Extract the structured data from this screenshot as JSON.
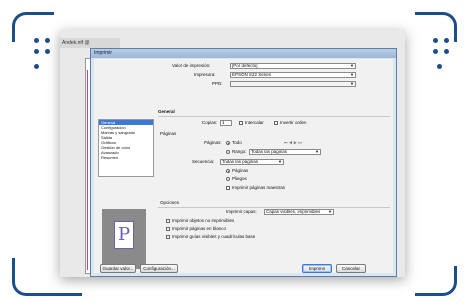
{
  "background_doc": {
    "tab_label": "Andek.ntf @"
  },
  "dialog": {
    "title": "Imprimir",
    "valor_label": "Valor de impresión:",
    "valor_value": "[Por defecto]",
    "impresora_label": "Impresora:",
    "impresora_value": "EPSON S22 Series",
    "ppd_label": "PPD:",
    "ppd_value": "",
    "sidebar": [
      "General",
      "Configuración",
      "Marcas y sangrado",
      "Salida",
      "Gráficos",
      "Gestión de color",
      "Avanzado",
      "Resumen"
    ],
    "general_title": "General",
    "copias_label": "Copias:",
    "copias_value": "1",
    "intercalar_label": "Intercalar",
    "invertir_label": "Invertir orden",
    "paginas_title": "Páginas",
    "paginas_label": "Páginas:",
    "todo_label": "Todo",
    "pager_glyphs": "⏮ ◀ ▶ ⏭",
    "rango_label": "Rango:",
    "rango_value": "Todas las páginas",
    "secuencia_label": "Secuencia:",
    "secuencia_value": "Todas las páginas",
    "paginas_radio_label": "Páginas",
    "pliegos_label": "Pliegos",
    "imprimir_maestras_label": "Imprimir páginas maestras",
    "opciones_title": "Opciones",
    "imprimir_capas_label": "Imprimir capas:",
    "imprimir_capas_value": "Capas visibles, imprimibles",
    "opt1": "Imprimir objetos no imprimibles",
    "opt2": "Imprimir páginas en blanco",
    "opt3": "Imprimir guías visibles y cuadrículas base",
    "preview_letter": "P",
    "btn_guardar": "Guardar valor...",
    "btn_config": "Configuración...",
    "btn_imprimir": "Imprimir",
    "btn_cancelar": "Cancelar"
  }
}
